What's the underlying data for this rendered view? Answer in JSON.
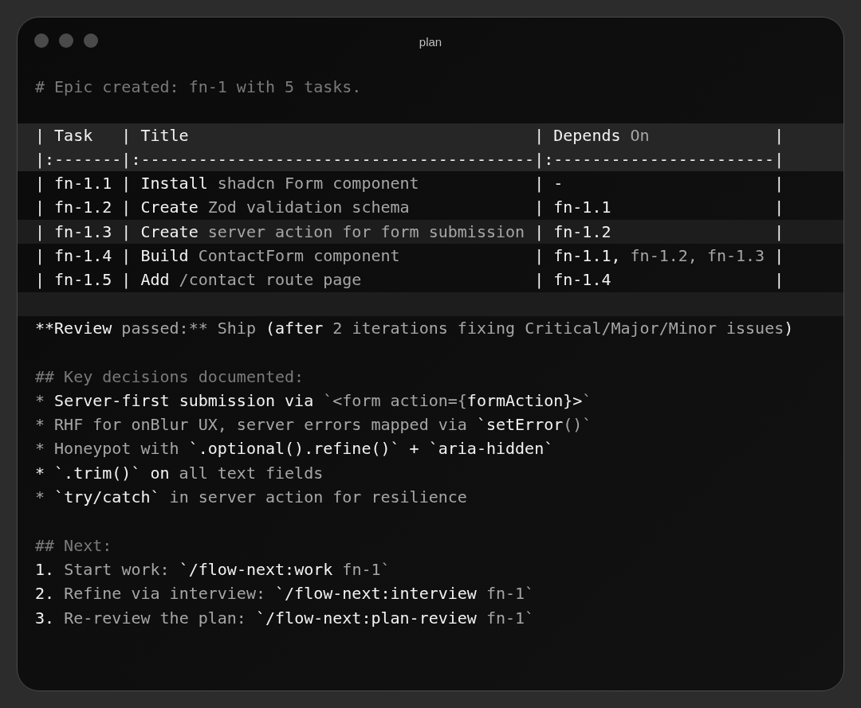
{
  "window": {
    "title": "plan"
  },
  "lines": [
    {
      "kind": "line",
      "segments": [
        {
          "text": "# Epic created: fn-1 with 5 tasks.",
          "kind": "faint"
        }
      ]
    },
    {
      "kind": "blank"
    },
    {
      "kind": "header-line",
      "segments": [
        {
          "text": "| Task   | Title                                    | Depends",
          "kind": "bright"
        },
        {
          "text": " On",
          "kind": "dim"
        },
        {
          "text": "             |",
          "kind": "bright"
        }
      ]
    },
    {
      "kind": "header-line",
      "segments": [
        {
          "text": "|:-------|:-----------------------------------------|:-----------------------|",
          "kind": "bright"
        }
      ]
    },
    {
      "kind": "line",
      "segments": [
        {
          "text": "| fn-1.1 | Install",
          "kind": "bright"
        },
        {
          "text": " shadcn Form component",
          "kind": "dim"
        },
        {
          "text": "            | -                      |",
          "kind": "bright"
        }
      ]
    },
    {
      "kind": "line",
      "segments": [
        {
          "text": "| fn-1.2 | Create",
          "kind": "bright"
        },
        {
          "text": " Zod validation schema",
          "kind": "dim"
        },
        {
          "text": "             | fn-1.1                 |",
          "kind": "bright"
        }
      ]
    },
    {
      "kind": "highlighted-line",
      "segments": [
        {
          "text": "| fn-1.3 | Create",
          "kind": "bright"
        },
        {
          "text": " server action for form submission",
          "kind": "dim"
        },
        {
          "text": " | fn-1.2                 |",
          "kind": "bright"
        }
      ]
    },
    {
      "kind": "line",
      "segments": [
        {
          "text": "| fn-1.4 | Build",
          "kind": "bright"
        },
        {
          "text": " ContactForm component",
          "kind": "dim"
        },
        {
          "text": "              | fn-1.1,",
          "kind": "bright"
        },
        {
          "text": " fn-1.2, fn-1.3",
          "kind": "dim"
        },
        {
          "text": " |",
          "kind": "bright"
        }
      ]
    },
    {
      "kind": "line",
      "segments": [
        {
          "text": "| fn-1.5 | Add",
          "kind": "bright"
        },
        {
          "text": " /contact route page",
          "kind": "dim"
        },
        {
          "text": "                  | fn-1.4                 |",
          "kind": "bright"
        }
      ]
    },
    {
      "kind": "highlighted-blank"
    },
    {
      "kind": "line",
      "segments": [
        {
          "text": "**Review",
          "kind": "bright"
        },
        {
          "text": " passed:**",
          "kind": "dim"
        },
        {
          "text": " Ship",
          "kind": "dim"
        },
        {
          "text": " (after",
          "kind": "bright"
        },
        {
          "text": " 2 iterations fixing Critical/Major/Minor issues",
          "kind": "dim"
        },
        {
          "text": ")",
          "kind": "bright"
        }
      ]
    },
    {
      "kind": "blank"
    },
    {
      "kind": "line",
      "segments": [
        {
          "text": "## Key decisions documented:",
          "kind": "faint"
        }
      ]
    },
    {
      "kind": "line",
      "segments": [
        {
          "text": "* ",
          "kind": "dim"
        },
        {
          "text": "Server-first submission via",
          "kind": "bright"
        },
        {
          "text": " `<form action={",
          "kind": "dim"
        },
        {
          "text": "formAction}>",
          "kind": "bright"
        },
        {
          "text": "`",
          "kind": "dim"
        }
      ]
    },
    {
      "kind": "line",
      "segments": [
        {
          "text": "* RHF for onBlur UX, server errors mapped via",
          "kind": "dim"
        },
        {
          "text": " `setError",
          "kind": "bright"
        },
        {
          "text": "()`",
          "kind": "dim"
        }
      ]
    },
    {
      "kind": "line",
      "segments": [
        {
          "text": "* Honeypot with",
          "kind": "dim"
        },
        {
          "text": " `.optional().refine()` + `aria-hidden`",
          "kind": "bright"
        }
      ]
    },
    {
      "kind": "line",
      "segments": [
        {
          "text": "* `.trim()` on",
          "kind": "bright"
        },
        {
          "text": " all text fields",
          "kind": "dim"
        }
      ]
    },
    {
      "kind": "line",
      "segments": [
        {
          "text": "* ",
          "kind": "dim"
        },
        {
          "text": "`try/catch`",
          "kind": "bright"
        },
        {
          "text": " in server action for resilience",
          "kind": "dim"
        }
      ]
    },
    {
      "kind": "blank"
    },
    {
      "kind": "line",
      "segments": [
        {
          "text": "## Next:",
          "kind": "faint"
        }
      ]
    },
    {
      "kind": "line",
      "segments": [
        {
          "text": "1.",
          "kind": "bright"
        },
        {
          "text": " Start work:",
          "kind": "dim"
        },
        {
          "text": " `/flow-next:work",
          "kind": "bright"
        },
        {
          "text": " fn-1`",
          "kind": "dim"
        }
      ]
    },
    {
      "kind": "line",
      "segments": [
        {
          "text": "2.",
          "kind": "bright"
        },
        {
          "text": " Refine via interview:",
          "kind": "dim"
        },
        {
          "text": " `/flow-next:interview",
          "kind": "bright"
        },
        {
          "text": " fn-1`",
          "kind": "dim"
        }
      ]
    },
    {
      "kind": "line",
      "segments": [
        {
          "text": "3.",
          "kind": "bright"
        },
        {
          "text": " Re-review the plan:",
          "kind": "dim"
        },
        {
          "text": " `/flow-next:plan-review",
          "kind": "bright"
        },
        {
          "text": " fn-1`",
          "kind": "dim"
        }
      ]
    }
  ]
}
